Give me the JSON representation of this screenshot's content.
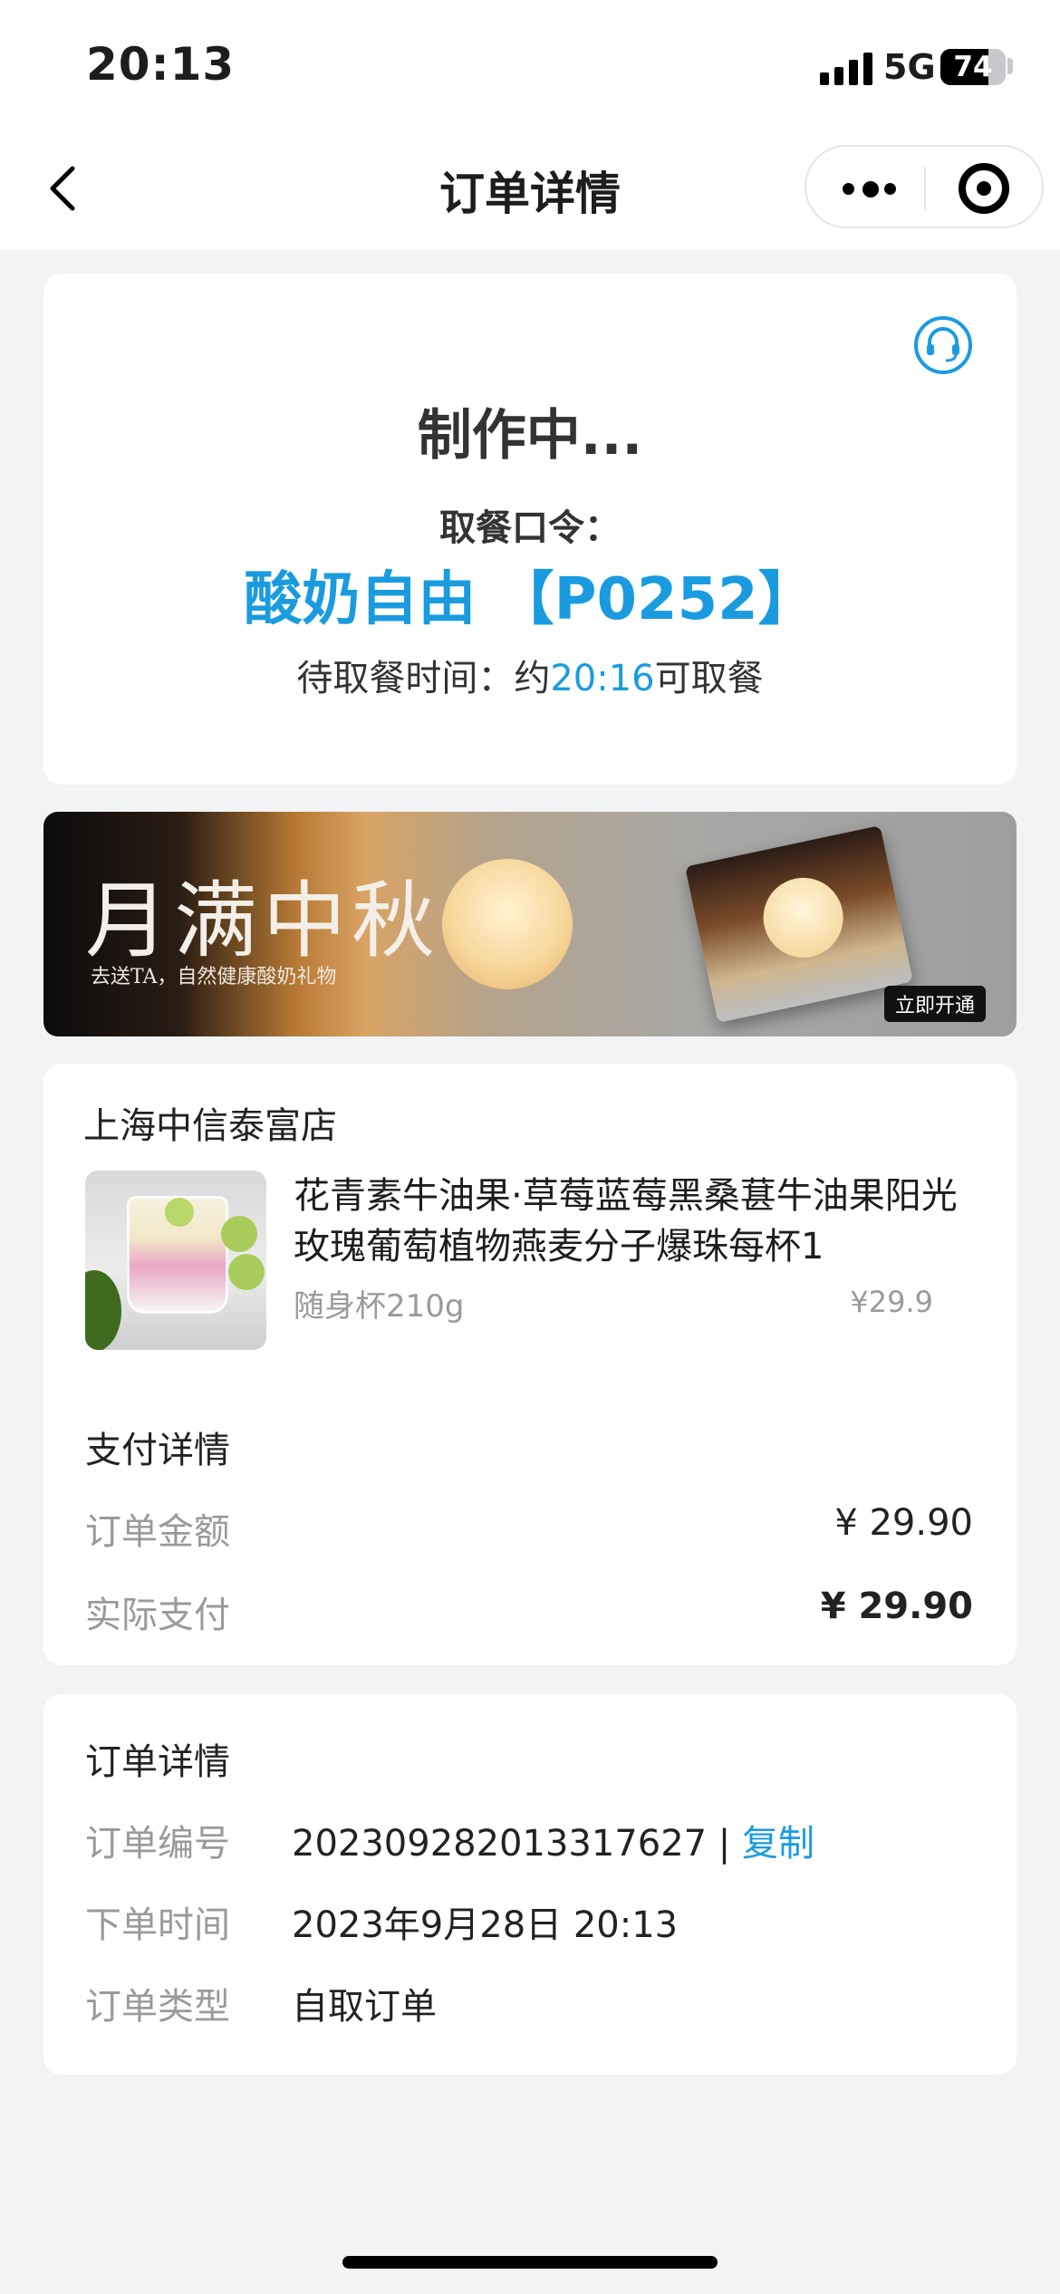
{
  "status_bar": {
    "time": "20:13",
    "network": "5G",
    "battery": "74",
    "battery_level": 0.74
  },
  "nav": {
    "title": "订单详情"
  },
  "order_status": {
    "state": "制作中...",
    "code_label": "取餐口令：",
    "code": "酸奶自由 【P0252】",
    "wait_prefix": "待取餐时间：约",
    "wait_time": "20:16",
    "wait_suffix": "可取餐"
  },
  "banner": {
    "title": "月满中秋",
    "subtitle": "去送TA，自然健康酸奶礼物",
    "cta": "立即开通"
  },
  "store": {
    "name": "上海中信泰富店"
  },
  "product": {
    "name": "花青素牛油果·草莓蓝莓黑桑葚牛油果阳光玫瑰葡萄植物燕麦分子爆珠每杯1",
    "spec": "随身杯210g",
    "price": "¥29.9"
  },
  "payment": {
    "title": "支付详情",
    "order_amount_label": "订单金额",
    "order_amount": "¥ 29.90",
    "actual_paid_label": "实际支付",
    "actual_paid": "¥ 29.90"
  },
  "detail": {
    "title": "订单详情",
    "order_no_label": "订单编号",
    "order_no": "202309282013317627",
    "separator": " | ",
    "copy_label": "复制",
    "order_time_label": "下单时间",
    "order_time": "2023年9月28日 20:13",
    "order_type_label": "订单类型",
    "order_type": "自取订单"
  },
  "colors": {
    "accent": "#1a9be0",
    "background": "#f2f3f5"
  }
}
